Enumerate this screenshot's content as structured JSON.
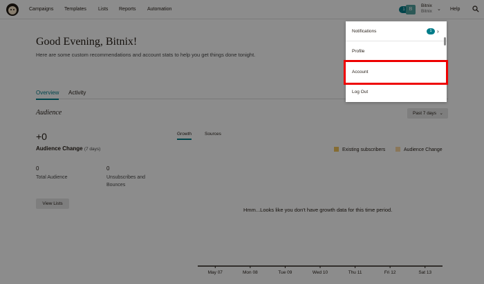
{
  "nav": {
    "links": [
      "Campaigns",
      "Templates",
      "Lists",
      "Reports",
      "Automation"
    ],
    "badge_count": "1",
    "avatar_letter": "B",
    "account_name": "Bitnix",
    "account_sub": "Bitnix",
    "help": "Help"
  },
  "page": {
    "greeting": "Good Evening, Bitnix!",
    "intro": "Here are some custom recommendations and account stats to help you get things done tonight.",
    "tabs": [
      "Overview",
      "Activity"
    ],
    "section_title": "Audience",
    "period": "Past 7 days"
  },
  "audience": {
    "change_value": "+0",
    "change_label": "Audience Change",
    "change_period": "(7 days)",
    "total_value": "0",
    "total_label": "Total Audience",
    "unsub_value": "0",
    "unsub_label": "Unsubscribes and Bounces",
    "view_lists": "View Lists"
  },
  "chart": {
    "tabs": [
      "Growth",
      "Sources"
    ],
    "legend": [
      {
        "label": "Existing subscribers",
        "color": "#f2c55c"
      },
      {
        "label": "Audience Change",
        "color": "#fbd9a3"
      }
    ],
    "empty_message": "Hmm...Looks like you don't have growth data for this time period."
  },
  "chart_data": {
    "type": "bar",
    "categories": [
      "May 07",
      "Mon 08",
      "Tue 09",
      "Wed 10",
      "Thu 11",
      "Fri 12",
      "Sat 13"
    ],
    "series": []
  },
  "dropdown": {
    "notifications": "Notifications",
    "notifications_count": "1",
    "profile": "Profile",
    "account": "Account",
    "logout": "Log Out"
  },
  "colors": {
    "accent": "#007c89",
    "highlight": "#ee0000"
  }
}
